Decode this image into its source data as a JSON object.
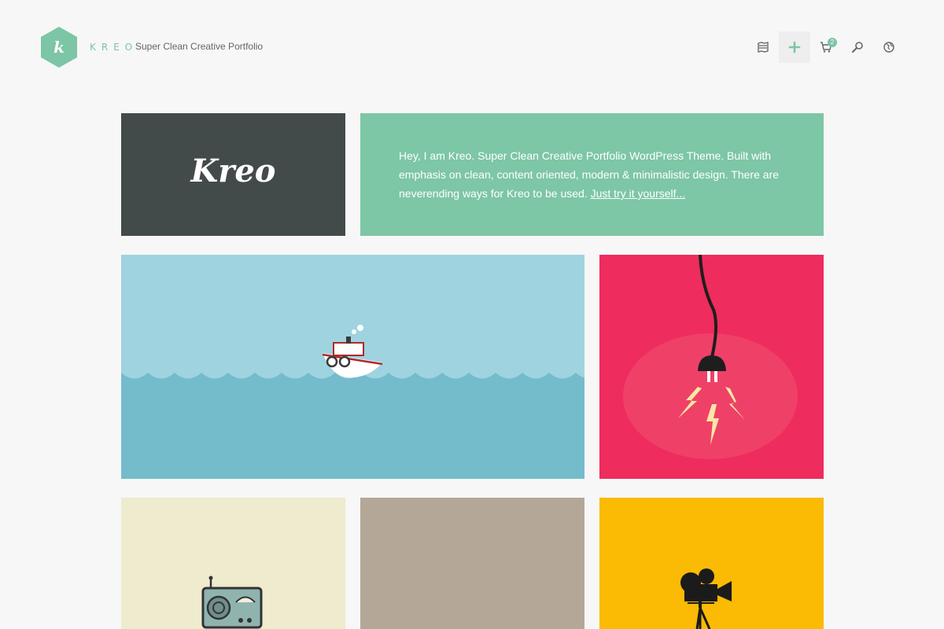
{
  "header": {
    "brand_name": "KREO",
    "logo_letter": "k",
    "tagline": "Super Clean Creative Portfolio",
    "nav": [
      {
        "name": "map-icon"
      },
      {
        "name": "plus-icon",
        "active": true
      },
      {
        "name": "cart-icon",
        "badge": "2"
      },
      {
        "name": "search-icon"
      },
      {
        "name": "globe-icon"
      }
    ]
  },
  "tiles": {
    "title": {
      "text": "Kreo"
    },
    "intro": {
      "text": "Hey, I am Kreo. Super Clean Creative Portfolio WordPress Theme. Built with emphasis on clean, content oriented, modern & minimalistic design. There are neverending ways for Kreo to be used.",
      "link_text": "Just try it yourself..."
    },
    "boat": {
      "icon": "boat-illustration"
    },
    "plug": {
      "icon": "plug-illustration"
    },
    "radio": {
      "icon": "radio-illustration"
    },
    "blank": {},
    "camera": {
      "icon": "camera-illustration"
    }
  },
  "colors": {
    "accent": "#7cc5a5",
    "title_tile": "#434b4a",
    "intro_tile": "#7dc6a6",
    "sky": "#9fd3e0",
    "sea": "#74bccb",
    "plug_tile": "#ee2c5e",
    "radio_tile": "#eeebce",
    "brown_tile": "#b4a797",
    "camera_tile": "#fbba03"
  }
}
